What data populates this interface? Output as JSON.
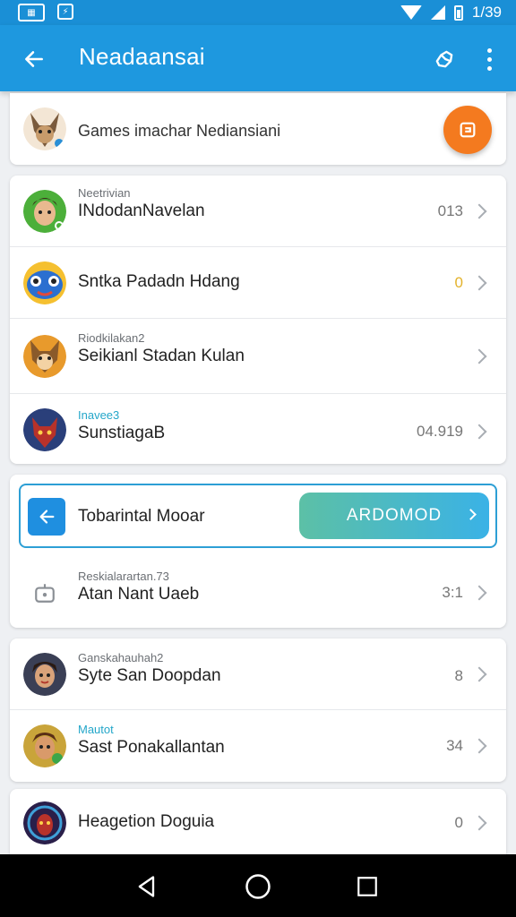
{
  "status_bar": {
    "time": "1/39"
  },
  "app_bar": {
    "title": "Neadaansai"
  },
  "header": {
    "title": "Games  imachar  Nediansiani"
  },
  "list1": [
    {
      "subtitle": "Neetrivian",
      "title": "INdodanNavelan",
      "value": "013"
    },
    {
      "subtitle": "",
      "title": "Sntka Padadn Hdang",
      "value": "0"
    },
    {
      "subtitle": "Riodkilakan2",
      "title": "Seikianl Stadan Kulan",
      "value": ""
    },
    {
      "subtitle": "Inavee3",
      "title": "SunstiagaB",
      "value": "04.919"
    }
  ],
  "highlight": {
    "title": "Tobarintal Mooar",
    "button_label": "ARDOMOD"
  },
  "file_row": {
    "subtitle": "Reskialarartan.73",
    "title": "Atan Nant Uaeb",
    "value": "3:1"
  },
  "list2": [
    {
      "subtitle": "Ganskahauhah2",
      "title": "Syte San Doopdan",
      "value": "8"
    },
    {
      "subtitle": "Mautot",
      "title": "Sast Ponakallantan",
      "value": "34"
    }
  ],
  "list3": [
    {
      "title": "Heagetion Doguia",
      "value": "0"
    }
  ],
  "colors": {
    "primary": "#1e98df",
    "accent_orange": "#f47a1f",
    "highlight_border": "#2d9fd5"
  }
}
